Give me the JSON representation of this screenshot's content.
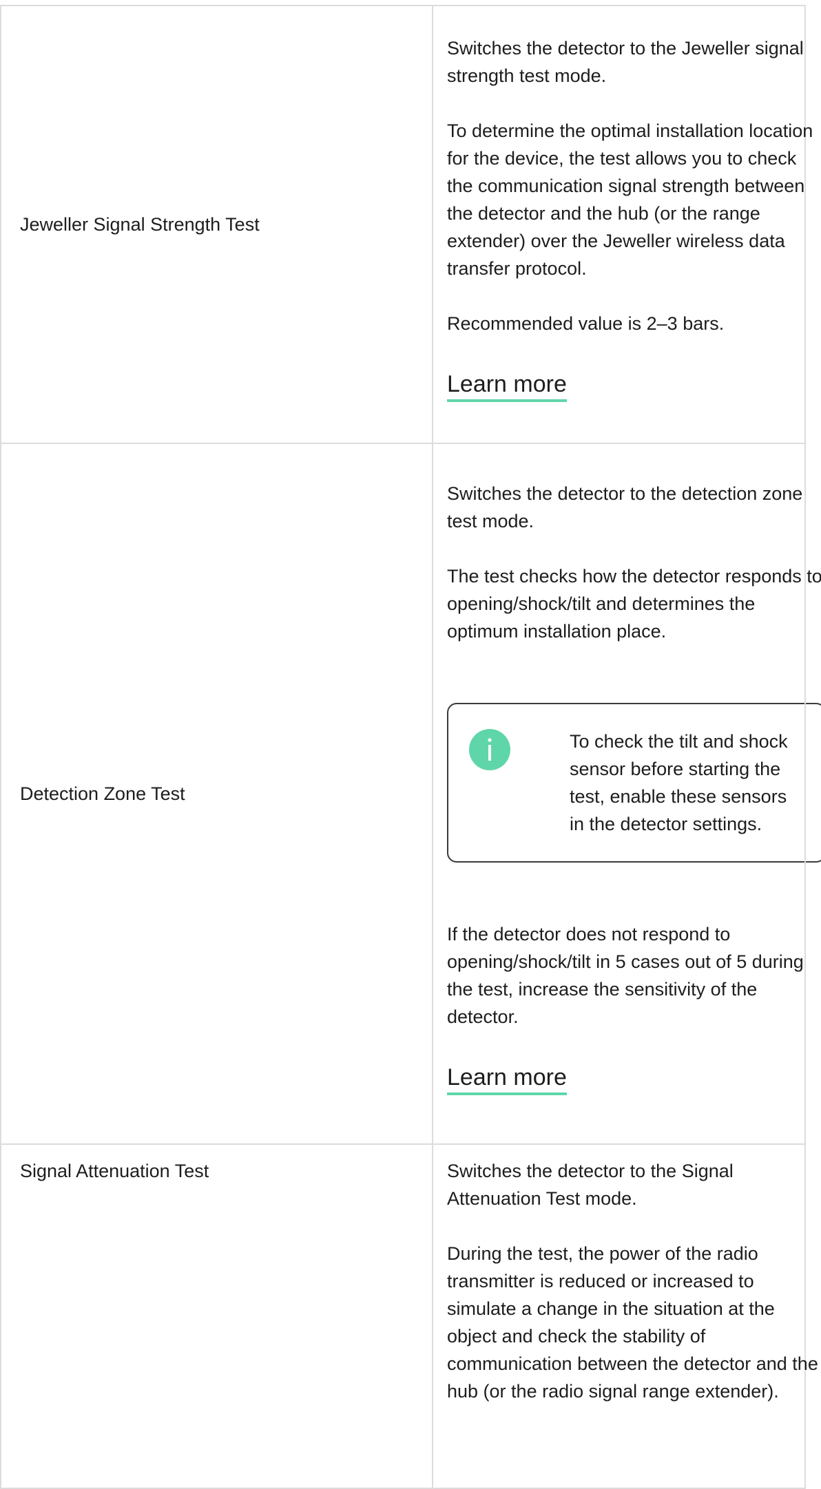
{
  "rows": [
    {
      "name": "Jeweller Signal Strength Test",
      "paragraphs": [
        "Switches the detector to the Jeweller signal strength test mode.",
        "To determine the optimal installation location for the device, the test allows you to check the communication signal strength between the detector and the hub (or the range extender) over the Jeweller wireless data transfer protocol.",
        "Recommended value is 2–3 bars."
      ],
      "link": "Learn more"
    },
    {
      "name": "Detection Zone Test",
      "paragraphs_before": [
        "Switches the detector to the detection zone test mode.",
        "The test checks how the detector responds to opening/shock/tilt and determines the optimum installation place."
      ],
      "info_box": {
        "icon": "info-icon",
        "text": "To check the tilt and shock sensor before starting the test, enable these sensors in the detector settings."
      },
      "paragraphs_after": [
        "If the detector does not respond to opening/shock/tilt in 5 cases out of 5 during the test, increase the sensitivity of the detector."
      ],
      "link": "Learn more"
    },
    {
      "name": "Signal Attenuation Test",
      "paragraphs": [
        "Switches the detector to the Signal Attenuation Test mode.",
        "During the test, the power of the radio transmitter is reduced or increased to simulate a change in the situation at the object and check the stability of communication between the detector and the hub (or the radio signal range extender)."
      ]
    }
  ],
  "colors": {
    "accent": "#5fd6a9",
    "border": "#dcdcdc",
    "text": "#1d1d1d"
  }
}
